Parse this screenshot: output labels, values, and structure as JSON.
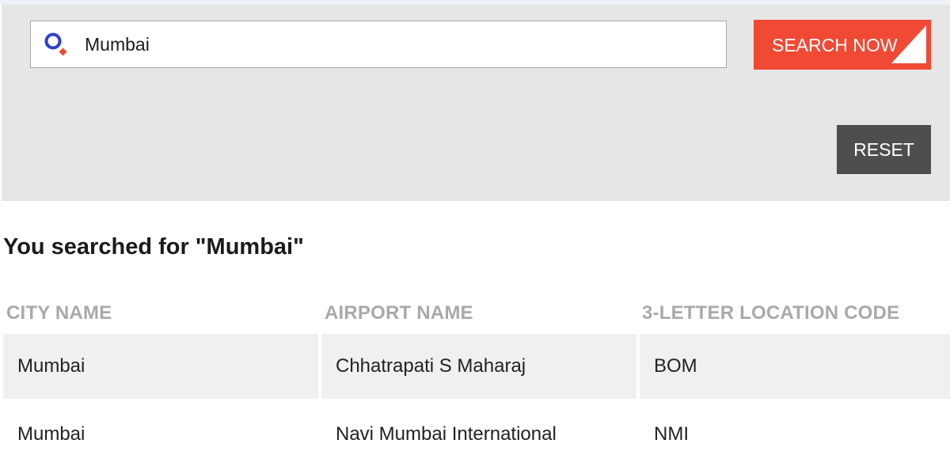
{
  "search": {
    "value": "Mumbai",
    "placeholder": "",
    "button_label": "SEARCH NOW"
  },
  "reset_label": "RESET",
  "result_heading": "You searched for \"Mumbai\"",
  "table": {
    "headers": [
      "CITY NAME",
      "AIRPORT NAME",
      "3-LETTER LOCATION CODE"
    ],
    "rows": [
      [
        "Mumbai",
        "Chhatrapati S Maharaj",
        "BOM"
      ],
      [
        "Mumbai",
        "Navi Mumbai International",
        "NMI"
      ]
    ]
  },
  "colors": {
    "accent": "#f04a35",
    "reset": "#4e4e4e",
    "panel": "#e6e6e6",
    "icon_ring": "#2b3fd1",
    "icon_handle": "#f04a35",
    "header_text": "#a9a9a9",
    "row_fill": "#f0f0f0"
  },
  "icons": {
    "search": "search-icon"
  }
}
